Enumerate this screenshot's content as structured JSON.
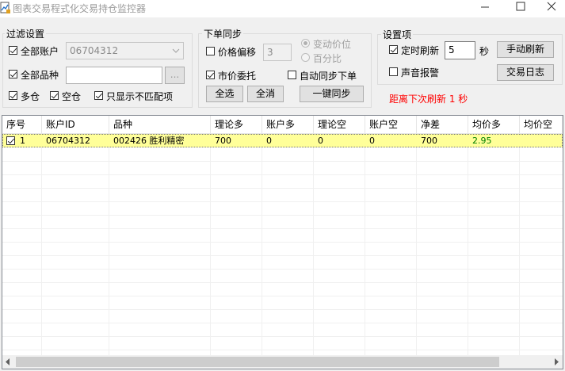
{
  "window": {
    "title": "图表交易程式化交易持仓监控器",
    "icon": "chart-app-icon",
    "controls": [
      "minimize-icon",
      "maximize-icon",
      "close-icon"
    ]
  },
  "filter": {
    "legend": "过滤设置",
    "all_accounts": {
      "label": "全部账户",
      "checked": true
    },
    "account_value": "06704312",
    "all_products": {
      "label": "全部品种",
      "checked": true
    },
    "product_value": "",
    "browse_label": "...",
    "long": {
      "label": "多仓",
      "checked": true
    },
    "short": {
      "label": "空仓",
      "checked": true
    },
    "mismatch_only": {
      "label": "只显示不匹配项",
      "checked": true
    }
  },
  "order_sync": {
    "legend": "下单同步",
    "price_offset": {
      "label": "价格偏移",
      "checked": false
    },
    "offset_value": "3",
    "radio_var_tick": "变动价位",
    "radio_percent": "百分比",
    "market_order": {
      "label": "市价委托",
      "checked": true
    },
    "auto_sync": {
      "label": "自动同步下单",
      "checked": false
    },
    "select_all": "全选",
    "cancel_all": "全消",
    "one_click_sync": "一键同步"
  },
  "settings": {
    "legend": "设置项",
    "timed_refresh": {
      "label": "定时刷新",
      "checked": true
    },
    "interval_value": "5",
    "interval_unit": "秒",
    "manual_refresh": "手动刷新",
    "sound_alarm": {
      "label": "声音报警",
      "checked": false
    },
    "trade_log": "交易日志",
    "next_refresh_text": "距离下次刷新 1 秒",
    "alert_color": "#ff0000"
  },
  "table": {
    "columns": [
      "序号",
      "账户ID",
      "品种",
      "理论多",
      "账户多",
      "理论空",
      "账户空",
      "净差",
      "均价多",
      "均价空"
    ],
    "rows": [
      {
        "checked": true,
        "cells": [
          "1",
          "06704312",
          "002426 胜利精密",
          "700",
          "0",
          "0",
          "0",
          "700",
          "2.95",
          ""
        ]
      }
    ],
    "row_highlight_color": "#ffff99",
    "avg_price_color": "#008000"
  }
}
